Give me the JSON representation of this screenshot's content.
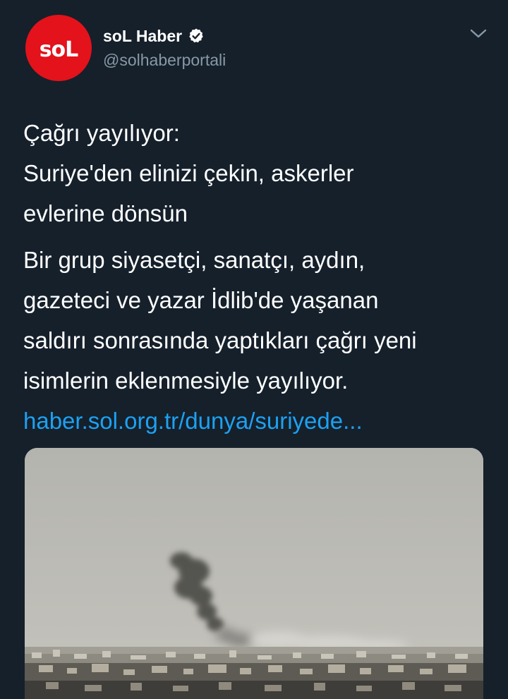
{
  "user": {
    "display_name": "soL Haber",
    "handle": "@solhaberportali",
    "avatar_text": "soL",
    "verified": true
  },
  "tweet": {
    "headline_lines": [
      "Çağrı yayılıyor:",
      "Suriye'den elinizi çekin, askerler",
      "evlerine dönsün"
    ],
    "body_lines": [
      "Bir grup siyasetçi, sanatçı, aydın,",
      "gazeteci ve yazar İdlib'de yaşanan",
      "saldırı sonrasında yaptıkları çağrı yeni",
      "isimlerin eklenmesiyle yayılıyor."
    ],
    "link_text": "haber.sol.org.tr/dunya/suriyede..."
  },
  "colors": {
    "background": "#15202b",
    "secondary_text": "#8899a6",
    "link": "#1da1f2",
    "brand_red": "#e3121b"
  },
  "icons": {
    "verified": "verified-badge-icon",
    "menu": "chevron-down-icon"
  }
}
